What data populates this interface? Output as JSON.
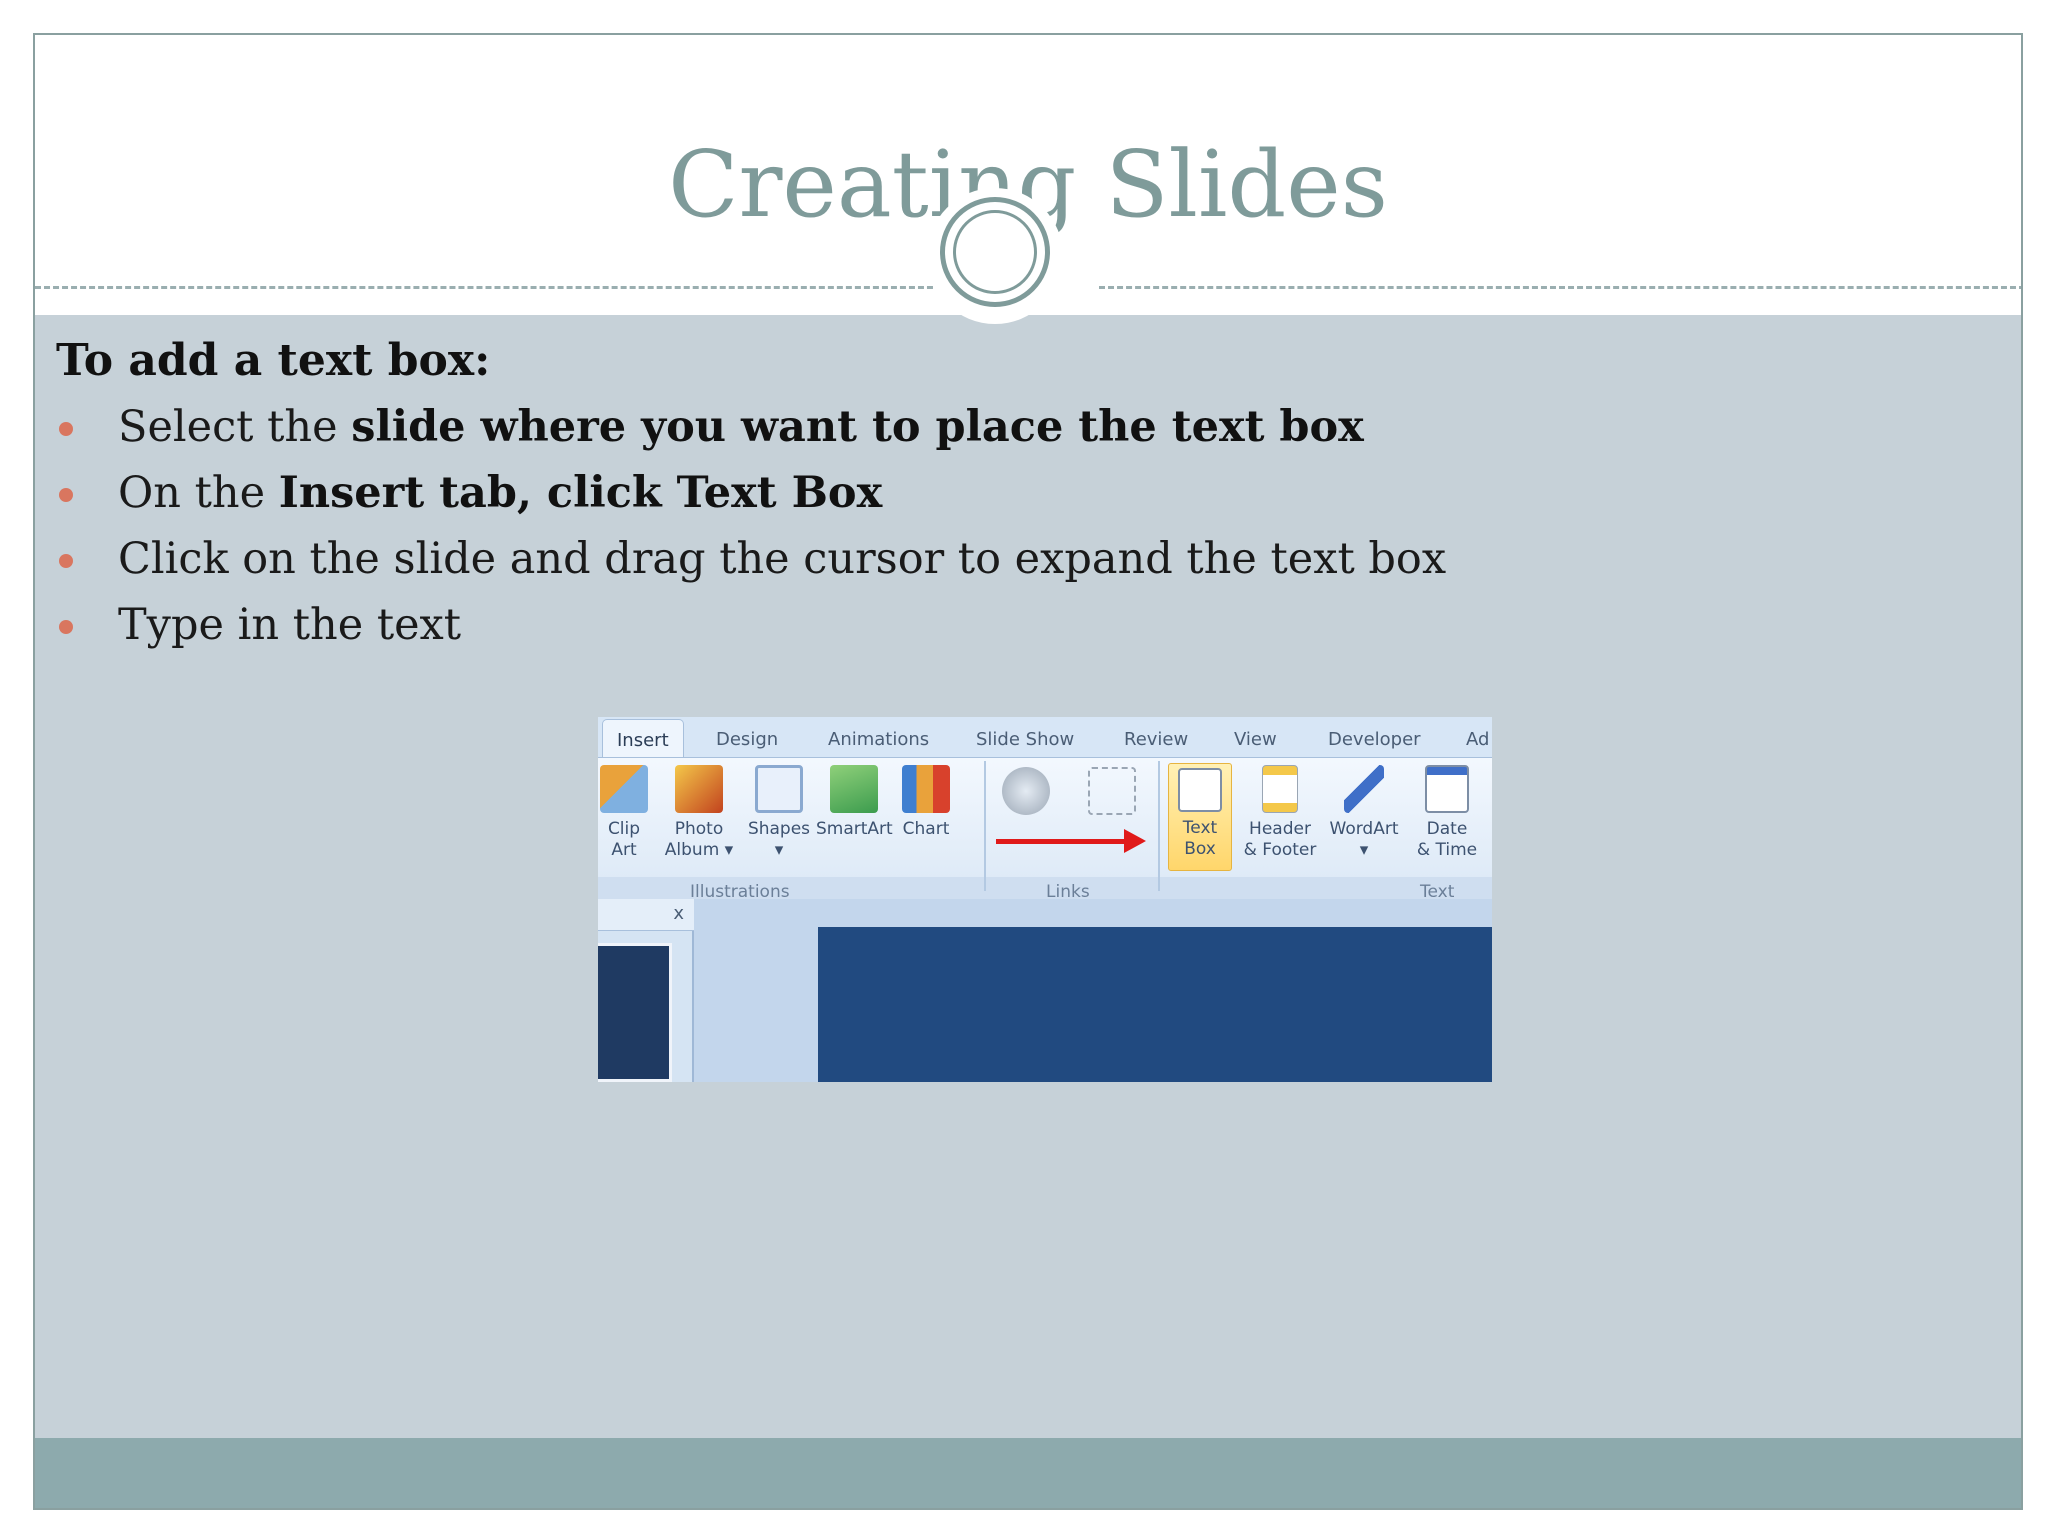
{
  "slide": {
    "title": "Creating Slides",
    "lead": "To add a text box:",
    "bullets": [
      {
        "pre": "Select the ",
        "bold": "slide where you want to place the text box",
        "post": ""
      },
      {
        "pre": "On the ",
        "bold": "Insert tab, click Text Box",
        "post": ""
      },
      {
        "pre": "Click on the slide and drag the cursor to expand the text box",
        "bold": "",
        "post": ""
      },
      {
        "pre": "Type in the text",
        "bold": "",
        "post": ""
      }
    ]
  },
  "ribbon": {
    "tabs": [
      "Insert",
      "Design",
      "Animations",
      "Slide Show",
      "Review",
      "View",
      "Developer",
      "Ad"
    ],
    "buttons": [
      {
        "label": "Clip\nArt",
        "icon": "clip-art-icon"
      },
      {
        "label": "Photo\nAlbum ▾",
        "icon": "photo-album-icon"
      },
      {
        "label": "Shapes\n▾",
        "icon": "shapes-icon"
      },
      {
        "label": "SmartArt",
        "icon": "smartart-icon"
      },
      {
        "label": "Chart",
        "icon": "chart-icon"
      },
      {
        "label": "Text\nBox",
        "icon": "text-box-icon"
      },
      {
        "label": "Header\n& Footer",
        "icon": "header-footer-icon"
      },
      {
        "label": "WordArt\n▾",
        "icon": "wordart-icon"
      },
      {
        "label": "Date\n& Time",
        "icon": "date-time-icon"
      }
    ],
    "groups": [
      "Illustrations",
      "Links",
      "Text"
    ],
    "close_glyph": "x"
  },
  "colors": {
    "title": "#7f9b9a",
    "body_bg": "#c6d1d8",
    "footer_bg": "#8daaad",
    "bullet": "#d9765f",
    "arrow": "#e01a1a"
  }
}
